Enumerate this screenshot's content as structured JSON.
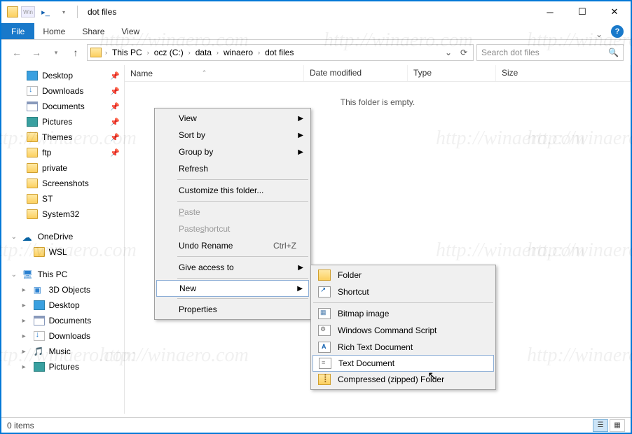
{
  "window": {
    "title": "dot files"
  },
  "ribbon": {
    "file": "File",
    "tabs": [
      "Home",
      "Share",
      "View"
    ]
  },
  "address": {
    "crumbs": [
      "This PC",
      "ocz (C:)",
      "data",
      "winaero",
      "dot files"
    ],
    "search_placeholder": "Search dot files"
  },
  "tree": {
    "quick": [
      {
        "label": "Desktop",
        "ico": "desktop",
        "pin": true
      },
      {
        "label": "Downloads",
        "ico": "dl",
        "pin": true
      },
      {
        "label": "Documents",
        "ico": "doc",
        "pin": true
      },
      {
        "label": "Pictures",
        "ico": "pic",
        "pin": true
      },
      {
        "label": "Themes",
        "ico": "folder",
        "pin": true
      },
      {
        "label": "ftp",
        "ico": "folder",
        "pin": true
      },
      {
        "label": "private",
        "ico": "folder"
      },
      {
        "label": "Screenshots",
        "ico": "folder"
      },
      {
        "label": "ST",
        "ico": "folder"
      },
      {
        "label": "System32",
        "ico": "folder"
      }
    ],
    "onedrive": {
      "label": "OneDrive",
      "children": [
        {
          "label": "WSL",
          "ico": "folder"
        }
      ]
    },
    "thispc": {
      "label": "This PC",
      "children": [
        {
          "label": "3D Objects",
          "ico": "obj3d"
        },
        {
          "label": "Desktop",
          "ico": "desktop"
        },
        {
          "label": "Documents",
          "ico": "doc"
        },
        {
          "label": "Downloads",
          "ico": "dl"
        },
        {
          "label": "Music",
          "ico": "music"
        },
        {
          "label": "Pictures",
          "ico": "pic"
        }
      ]
    }
  },
  "columns": {
    "name": "Name",
    "date": "Date modified",
    "type": "Type",
    "size": "Size"
  },
  "empty_msg": "This folder is empty.",
  "status": {
    "items": "0 items"
  },
  "ctx": {
    "view": "View",
    "sortby": "Sort by",
    "groupby": "Group by",
    "refresh": "Refresh",
    "customize": "Customize this folder...",
    "paste": "Paste",
    "paste_shortcut": "Paste shortcut",
    "undo": "Undo Rename",
    "undo_key": "Ctrl+Z",
    "give_access": "Give access to",
    "new": "New",
    "properties": "Properties"
  },
  "submenu": {
    "folder": "Folder",
    "shortcut": "Shortcut",
    "bmp": "Bitmap image",
    "cmd": "Windows Command Script",
    "rtf": "Rich Text Document",
    "txt": "Text Document",
    "zip": "Compressed (zipped) Folder"
  },
  "watermark": "http://winaero.com"
}
